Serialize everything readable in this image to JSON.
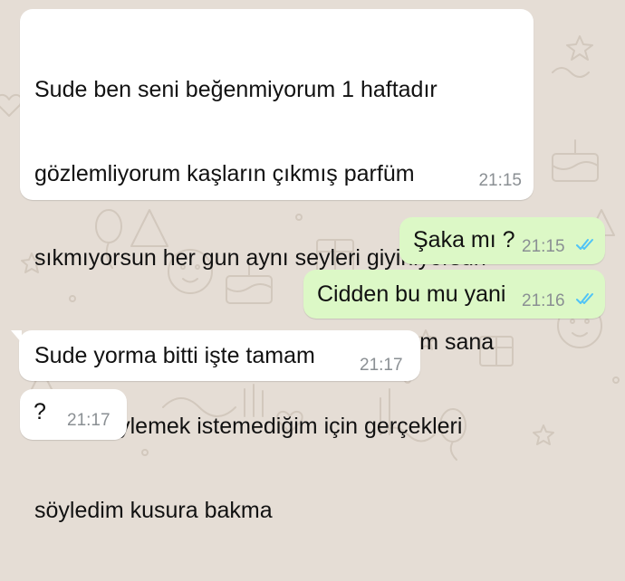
{
  "colors": {
    "background": "#e5ddd5",
    "incoming_bubble": "#ffffff",
    "outgoing_bubble": "#dcf8c6",
    "read_ticks": "#4fc3f7",
    "timestamp": "#8a8f93"
  },
  "messages": [
    {
      "direction": "incoming",
      "lines": [
        "Sude ben seni beğenmiyorum 1 haftadır",
        "gözlemliyorum kaşların çıkmış parfüm",
        "sıkmıyorsun her gun aynı seyleri giyiniyorsun",
        "yanımda olmandan utanıyorum ayrılalım sana",
        "yalan söylemek istemediğim için gerçekleri",
        "söyledim kusura bakma"
      ],
      "time": "21:15"
    },
    {
      "direction": "outgoing",
      "text": "Şaka mı ?",
      "time": "21:15",
      "status_icon": "double-check-read-icon"
    },
    {
      "direction": "outgoing",
      "text": "Cidden bu mu yani",
      "time": "21:16",
      "status_icon": "double-check-read-icon"
    },
    {
      "direction": "incoming",
      "text": "Sude yorma bitti işte tamam",
      "time": "21:17"
    },
    {
      "direction": "incoming",
      "text": "?",
      "time": "21:17"
    }
  ]
}
